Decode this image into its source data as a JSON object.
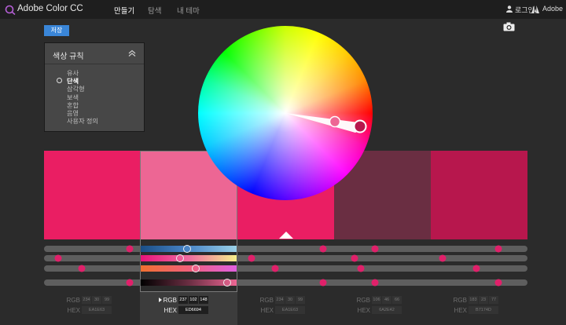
{
  "header": {
    "app_title": "Adobe Color CC",
    "nav": [
      "만들기",
      "탐색",
      "내 테마"
    ],
    "login": "로그인",
    "adobe": "Adobe"
  },
  "toolbar": {
    "save_label": "저장"
  },
  "rule_panel": {
    "title": "색상 규칙",
    "rules": [
      "유사",
      "단색",
      "삼각형",
      "보색",
      "혼합",
      "음영",
      "사용자 정의"
    ],
    "selected_index": 1
  },
  "swatches": [
    {
      "hex": "EA1E63",
      "rgb": [
        "234",
        "30",
        "99"
      ]
    },
    {
      "hex": "ED6694",
      "rgb": [
        "237",
        "102",
        "148"
      ]
    },
    {
      "hex": "EA1E63",
      "rgb": [
        "234",
        "30",
        "99"
      ]
    },
    {
      "hex": "6A2E42",
      "rgb": [
        "106",
        "46",
        "66"
      ]
    },
    {
      "hex": "B7174D",
      "rgb": [
        "183",
        "23",
        "77"
      ]
    }
  ],
  "selected_swatch": 1,
  "labels": {
    "rgb": "RGB",
    "hex": "HEX"
  },
  "colors": {
    "accent": "#3a86d8",
    "background": "#2b2b2b",
    "topbar": "#1e1e1e"
  }
}
